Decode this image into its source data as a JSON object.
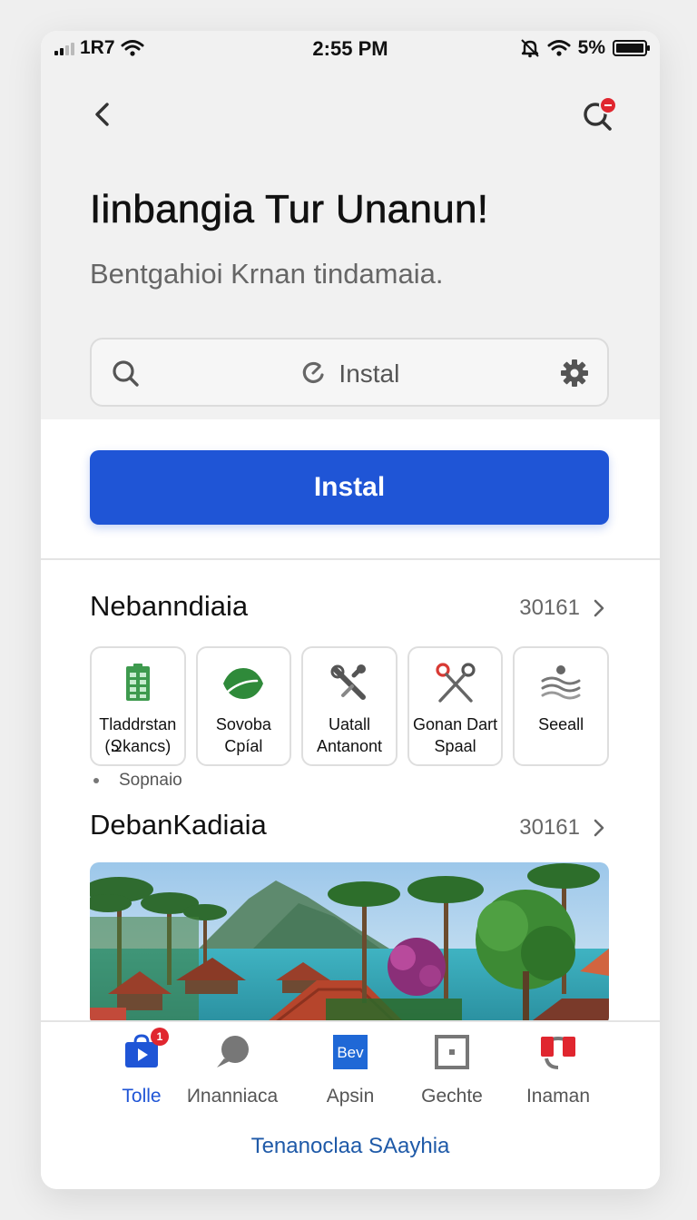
{
  "status_bar": {
    "carrier": "1R7",
    "time": "2:55 PM",
    "battery": "5%"
  },
  "header": {
    "title": "Iinbangia Tur Unanun!",
    "subtitle": "Bentgahioi Krnan tindamaia."
  },
  "search": {
    "value": "Instal"
  },
  "install_button": {
    "label": "Instal"
  },
  "section1": {
    "title": "Nebanndiaia",
    "more": "30161",
    "tiles": [
      {
        "label": "Tladdrstan\n(Ջkancs)",
        "icon": "spreadsheet-icon"
      },
      {
        "label": "Sovoba\nCpíal",
        "icon": "leaf-icon"
      },
      {
        "label": "Uatall\nAntanont",
        "icon": "tools-icon"
      },
      {
        "label": "Gonan Dart\nSpaal",
        "icon": "scissors-icon"
      },
      {
        "label": "Seeall",
        "icon": "waves-icon"
      }
    ],
    "note": "Sopnaio"
  },
  "section2": {
    "title": "DebanKadiaia",
    "more": "30161"
  },
  "tabbar": {
    "tabs": [
      {
        "label": "Tolle",
        "icon": "video-bag-icon",
        "badge": "1",
        "active": true
      },
      {
        "label": "Иnanniaca",
        "icon": "chat-bubble-icon"
      },
      {
        "label": "Apsin",
        "icon": "app-tile-icon",
        "icon_text": "Bev"
      },
      {
        "label": "Gechte",
        "icon": "frame-icon"
      },
      {
        "label": "Inaman",
        "icon": "headphones-icon"
      }
    ]
  },
  "footer_link": "Tenanoclaa SAayhia",
  "colors": {
    "accent": "#1f55d6",
    "badge": "#e0262f",
    "link": "#1f5aa8"
  }
}
